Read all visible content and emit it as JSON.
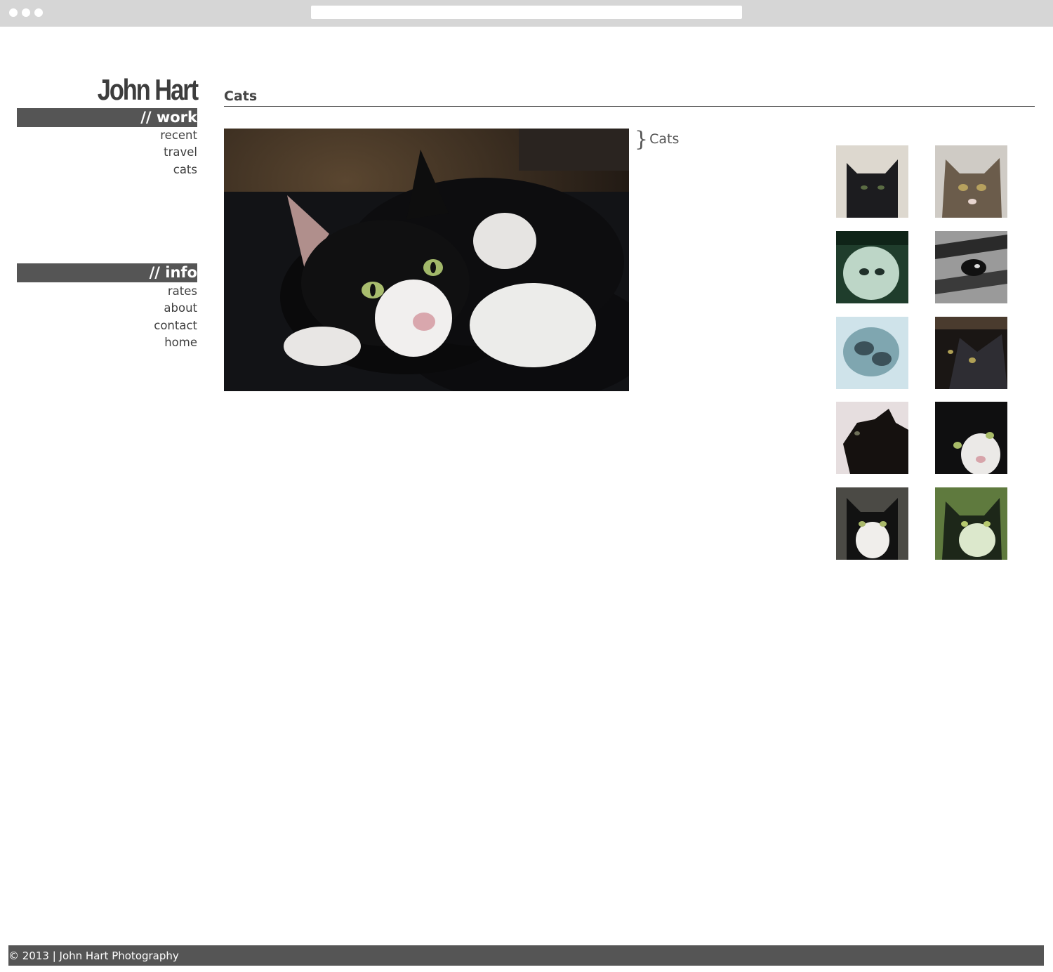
{
  "site": {
    "logo": "John Hart"
  },
  "nav": {
    "work_heading": "// work",
    "work_items": [
      "recent",
      "travel",
      "cats"
    ],
    "info_heading": "// info",
    "info_items": [
      "rates",
      "about",
      "contact",
      "home"
    ]
  },
  "gallery": {
    "title": "Cats",
    "caption": "Cats",
    "thumbnail_count": 10
  },
  "footer": {
    "text": "© 2013 | John Hart Photography"
  },
  "colors": {
    "nav_bar": "#555555",
    "text": "#444444",
    "chrome": "#d6d6d6"
  }
}
